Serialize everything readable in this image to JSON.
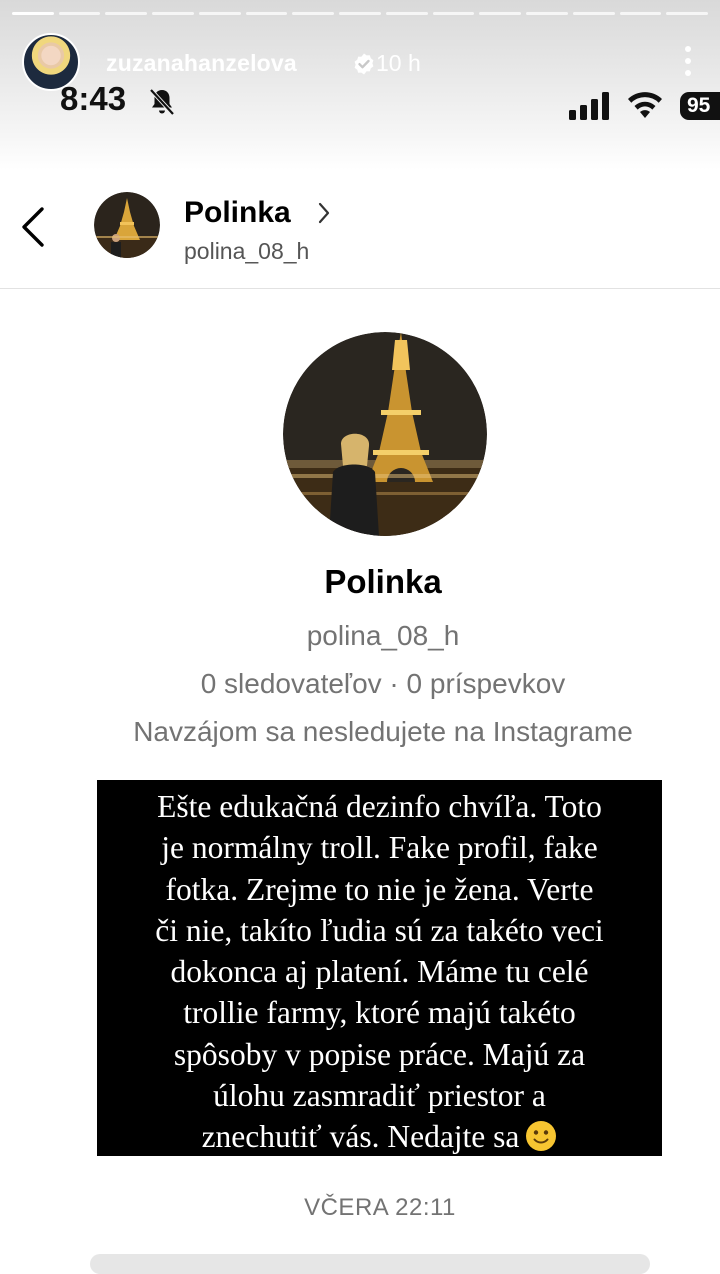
{
  "story": {
    "username": "zuzanahanzelova",
    "time_ago": "10 h",
    "segments_total": 15,
    "segments_done": 1
  },
  "status_bar": {
    "time": "8:43",
    "battery": "95"
  },
  "dm_header": {
    "name": "Polinka",
    "handle": "polina_08_h"
  },
  "profile": {
    "name": "Polinka",
    "handle": "polina_08_h",
    "stats": "0 sledovateľov · 0 príspevkov",
    "mutual": "Navzájom sa nesledujete na Instagrame"
  },
  "caption": {
    "lines": [
      "Ešte edukačná dezinfo chvíľa. Toto",
      "je normálny troll. Fake profil, fake",
      "fotka. Zrejme to nie je žena. Verte",
      "či nie, takíto ľudia sú za takéto veci",
      "dokonca aj platení. Máme tu celé",
      "trollie farmy, ktoré majú takéto",
      "spôsoby v popise práce. Majú za",
      "úlohu zasmradiť priestor a",
      "znechutiť vás. Nedajte sa"
    ],
    "emoji": "slightly-smiling-face-icon"
  },
  "timestamp": "VČERA 22:11",
  "colors": {
    "caption_bg": "#000000",
    "muted_text": "#737373",
    "verified_badge": "#ffffff"
  }
}
